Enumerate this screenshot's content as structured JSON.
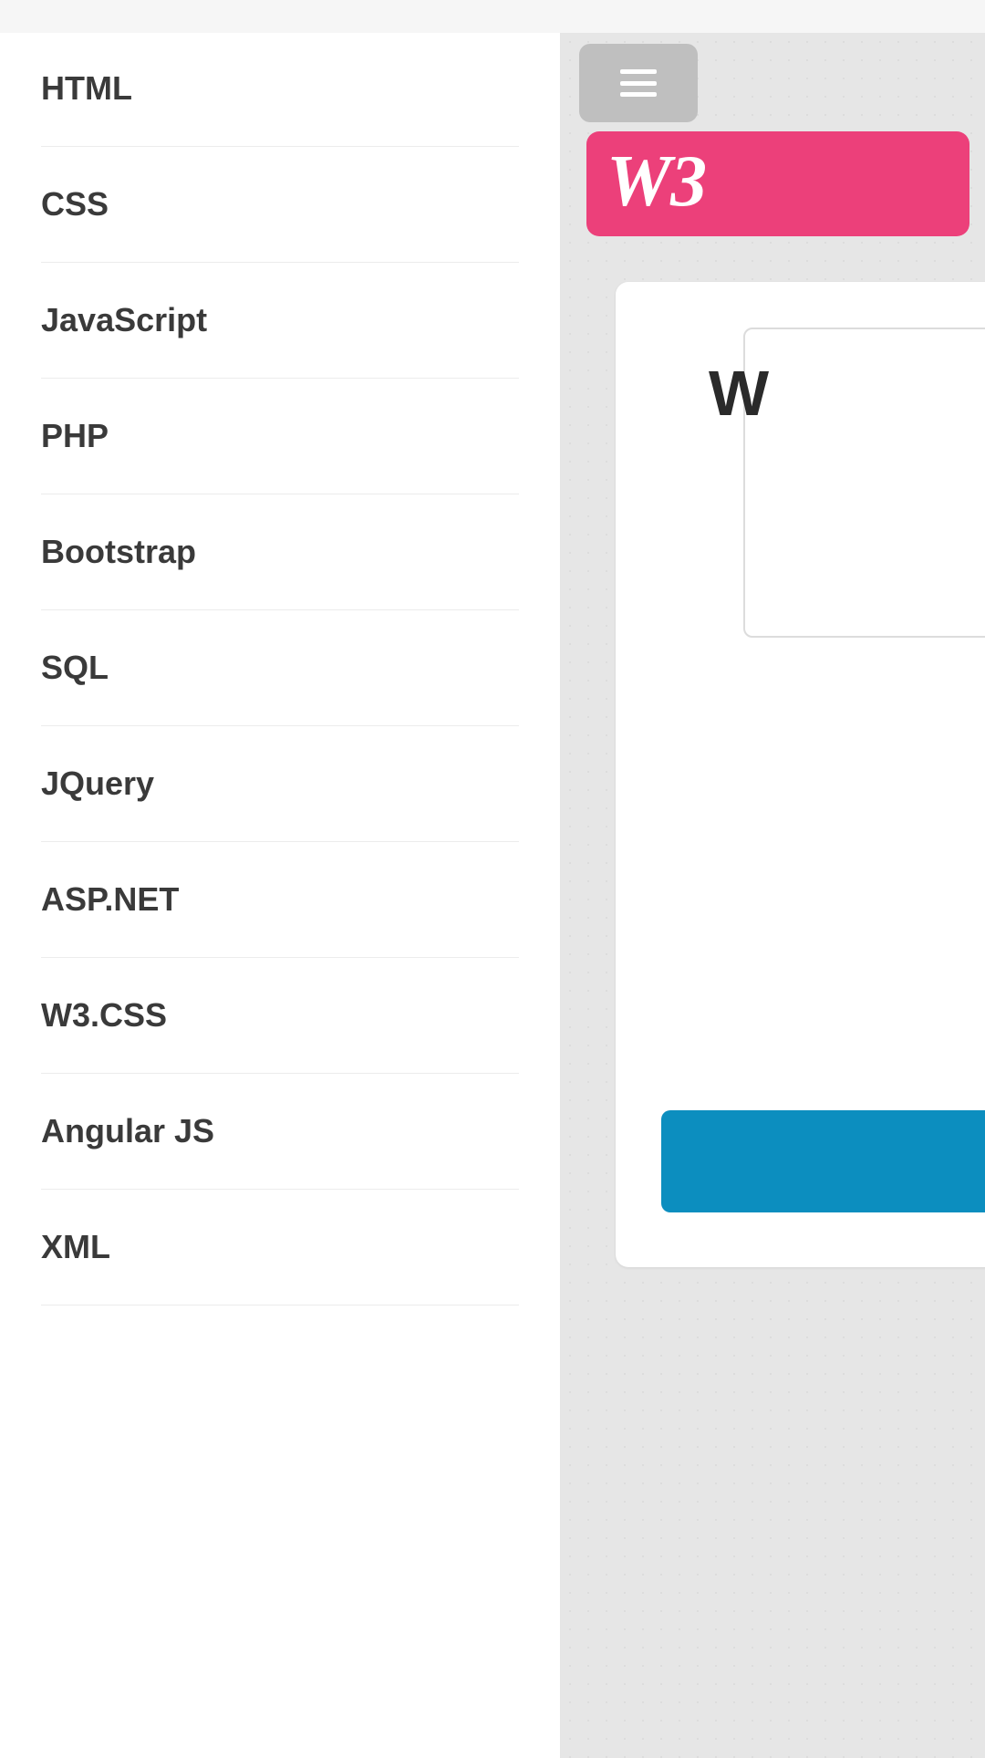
{
  "sidebar": {
    "items": [
      {
        "label": "HTML"
      },
      {
        "label": "CSS"
      },
      {
        "label": "JavaScript"
      },
      {
        "label": "PHP"
      },
      {
        "label": "Bootstrap"
      },
      {
        "label": "SQL"
      },
      {
        "label": "JQuery"
      },
      {
        "label": "ASP.NET"
      },
      {
        "label": "W3.CSS"
      },
      {
        "label": "Angular JS"
      },
      {
        "label": "XML"
      }
    ]
  },
  "logo": {
    "text": "W3"
  },
  "content": {
    "headline": "W"
  }
}
